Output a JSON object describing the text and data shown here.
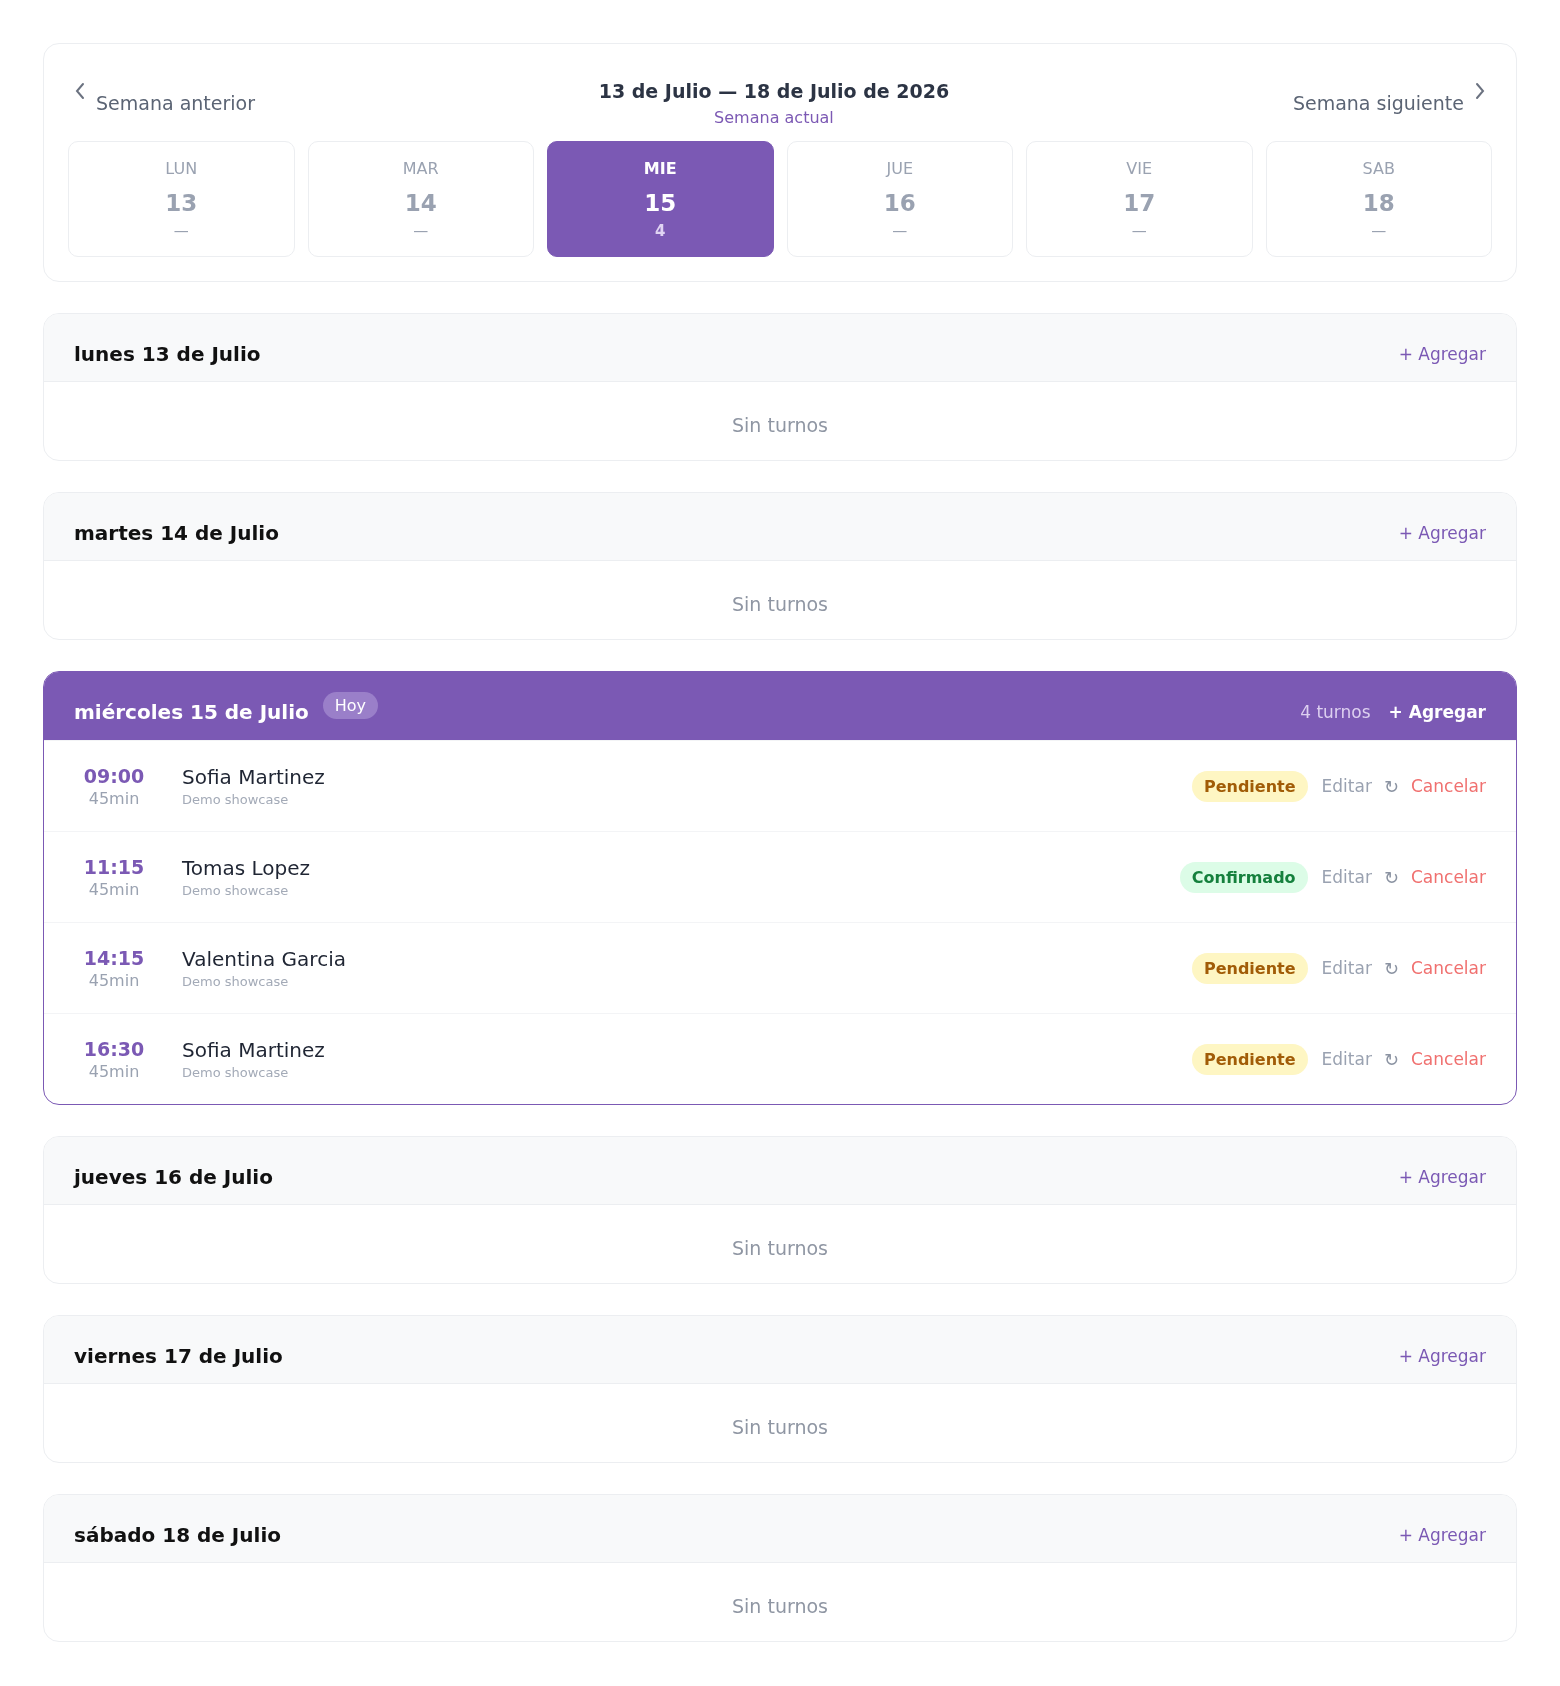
{
  "week_nav": {
    "prev_label": "Semana anterior",
    "title": "13 de Julio — 18 de Julio de 2026",
    "subtitle": "Semana actual",
    "next_label": "Semana siguiente"
  },
  "days": [
    {
      "abbr": "LUN",
      "number": "13",
      "count": "—",
      "selected": false
    },
    {
      "abbr": "MAR",
      "number": "14",
      "count": "—",
      "selected": false
    },
    {
      "abbr": "MIE",
      "number": "15",
      "count": "4",
      "selected": true
    },
    {
      "abbr": "JUE",
      "number": "16",
      "count": "—",
      "selected": false
    },
    {
      "abbr": "VIE",
      "number": "17",
      "count": "—",
      "selected": false
    },
    {
      "abbr": "SAB",
      "number": "18",
      "count": "—",
      "selected": false
    }
  ],
  "day_sections": [
    {
      "title": "lunes 13 de Julio",
      "selected": false,
      "add_label": "+ Agregar",
      "empty_text": "Sin turnos"
    },
    {
      "title": "martes 14 de Julio",
      "selected": false,
      "add_label": "+ Agregar",
      "empty_text": "Sin turnos"
    },
    {
      "title": "miércoles 15 de Julio",
      "selected": true,
      "badge": "Hoy",
      "count_label": "4 turnos",
      "add_label": "+ Agregar",
      "appointments": [
        {
          "time": "09:00",
          "duration": "45min",
          "client": "Sofia Martinez",
          "service": "Demo showcase",
          "status": {
            "label": "Pendiente",
            "kind": "pending"
          },
          "edit": "Editar",
          "reschedule": "↻",
          "cancel": "Cancelar"
        },
        {
          "time": "11:15",
          "duration": "45min",
          "client": "Tomas Lopez",
          "service": "Demo showcase",
          "status": {
            "label": "Confirmado",
            "kind": "confirmed"
          },
          "edit": "Editar",
          "reschedule": "↻",
          "cancel": "Cancelar"
        },
        {
          "time": "14:15",
          "duration": "45min",
          "client": "Valentina Garcia",
          "service": "Demo showcase",
          "status": {
            "label": "Pendiente",
            "kind": "pending"
          },
          "edit": "Editar",
          "reschedule": "↻",
          "cancel": "Cancelar"
        },
        {
          "time": "16:30",
          "duration": "45min",
          "client": "Sofia Martinez",
          "service": "Demo showcase",
          "status": {
            "label": "Pendiente",
            "kind": "pending"
          },
          "edit": "Editar",
          "reschedule": "↻",
          "cancel": "Cancelar"
        }
      ]
    },
    {
      "title": "jueves 16 de Julio",
      "selected": false,
      "add_label": "+ Agregar",
      "empty_text": "Sin turnos"
    },
    {
      "title": "viernes 17 de Julio",
      "selected": false,
      "add_label": "+ Agregar",
      "empty_text": "Sin turnos"
    },
    {
      "title": "sábado 18 de Julio",
      "selected": false,
      "add_label": "+ Agregar",
      "empty_text": "Sin turnos"
    }
  ]
}
